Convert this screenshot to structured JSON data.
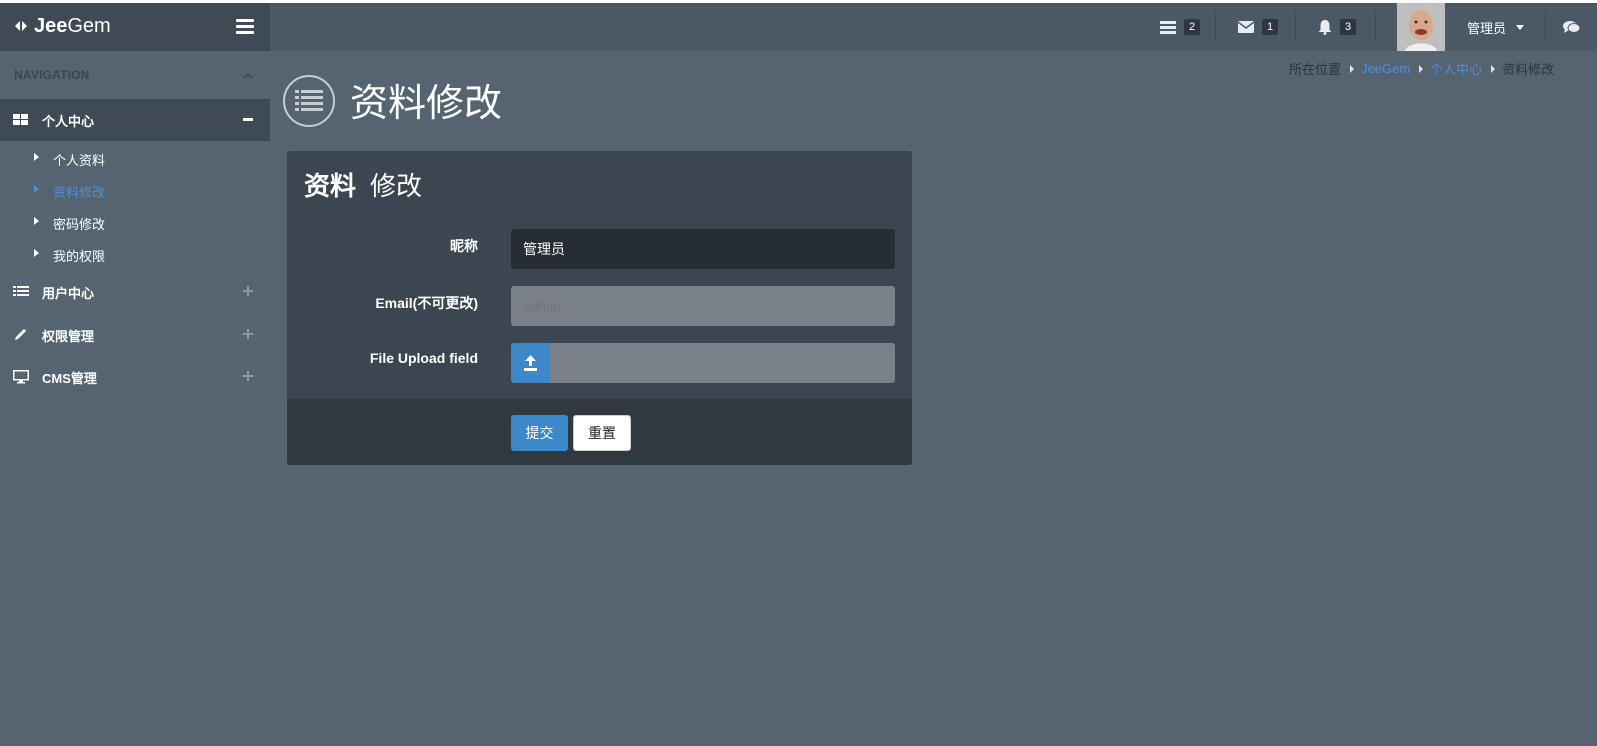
{
  "brand": {
    "name_bold": "Jee",
    "name_rest": "Gem"
  },
  "header": {
    "tasks_count": "2",
    "messages_count": "1",
    "notifications_count": "3",
    "user_name": "管理员"
  },
  "sidebar": {
    "title": "NAVIGATION",
    "groups": [
      {
        "label": "个人中心",
        "expanded": true,
        "items": [
          {
            "label": "个人资料"
          },
          {
            "label": "资料修改",
            "current": true
          },
          {
            "label": "密码修改"
          },
          {
            "label": "我的权限"
          }
        ]
      },
      {
        "label": "用户中心"
      },
      {
        "label": "权限管理"
      },
      {
        "label": "CMS管理"
      }
    ]
  },
  "page": {
    "title": "资料修改",
    "breadcrumb": [
      "所在位置",
      "JeeGem",
      "个人中心",
      "资料修改"
    ]
  },
  "form": {
    "heading_bold": "资料",
    "heading_rest": "修改",
    "nickname_label": "昵称",
    "nickname_value": "管理员",
    "email_label": "Email(不可更改)",
    "email_placeholder": "admin",
    "upload_label": "File Upload field",
    "submit_label": "提交",
    "reset_label": "重置"
  },
  "colors": {
    "accent": "#4a90d9",
    "button_primary": "#3d88c9",
    "background": "#566472"
  }
}
